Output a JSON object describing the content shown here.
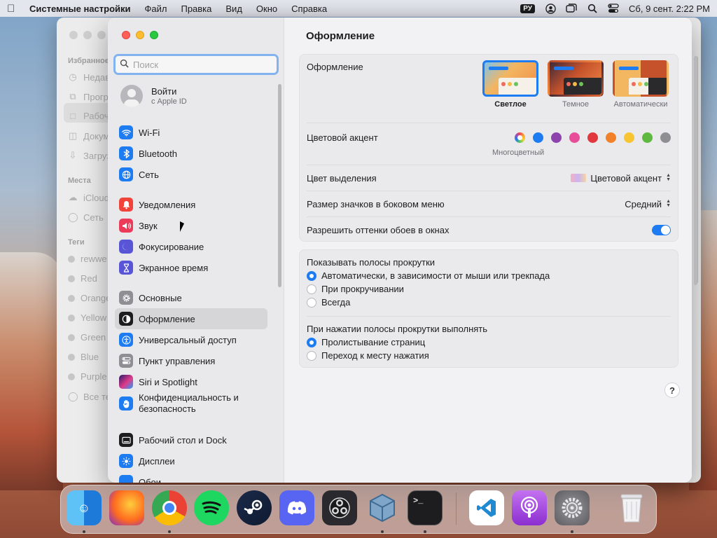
{
  "menubar": {
    "app_name": "Системные настройки",
    "items": [
      "Файл",
      "Правка",
      "Вид",
      "Окно",
      "Справка"
    ],
    "input_source": "РУ",
    "datetime": "Сб, 9 сент.  2:22 PM"
  },
  "finder": {
    "sections": [
      "Избранное",
      "Места",
      "Теги"
    ],
    "favorites": [
      "Недавние",
      "Программы",
      "Рабочий стол",
      "Документы",
      "Загрузки"
    ],
    "places": [
      "iCloud Drive",
      "Сеть"
    ],
    "tags": [
      "rewwe",
      "Red",
      "Orange",
      "Yellow",
      "Green",
      "Blue",
      "Purple",
      "Все теги…"
    ]
  },
  "sidebar": {
    "search_placeholder": "Поиск",
    "account": {
      "title": "Войти",
      "subtitle": "с Apple ID"
    },
    "items": [
      {
        "label": "Wi-Fi",
        "icon": "wifi-icon"
      },
      {
        "label": "Bluetooth",
        "icon": "bluetooth-icon"
      },
      {
        "label": "Сеть",
        "icon": "globe-icon"
      },
      {
        "label": "Уведомления",
        "icon": "bell-icon"
      },
      {
        "label": "Звук",
        "icon": "speaker-icon"
      },
      {
        "label": "Фокусирование",
        "icon": "moon-icon"
      },
      {
        "label": "Экранное время",
        "icon": "hourglass-icon"
      },
      {
        "label": "Основные",
        "icon": "gear-icon"
      },
      {
        "label": "Оформление",
        "icon": "appearance-icon"
      },
      {
        "label": "Универсальный доступ",
        "icon": "accessibility-icon"
      },
      {
        "label": "Пункт управления",
        "icon": "control-center-icon"
      },
      {
        "label": "Siri и Spotlight",
        "icon": "siri-icon"
      },
      {
        "label": "Конфиденциальность и безопасность",
        "icon": "hand-icon"
      },
      {
        "label": "Рабочий стол и Dock",
        "icon": "dock-icon"
      },
      {
        "label": "Дисплеи",
        "icon": "sun-icon"
      },
      {
        "label": "Обои",
        "icon": "wallpaper-icon"
      }
    ],
    "selected": "Оформление"
  },
  "content": {
    "title": "Оформление",
    "appearance_label": "Оформление",
    "themes": [
      {
        "label": "Светлое",
        "selected": true
      },
      {
        "label": "Темное",
        "selected": false
      },
      {
        "label": "Автоматически",
        "selected": false
      }
    ],
    "accent_label": "Цветовой акцент",
    "accent_caption": "Многоцветный",
    "accent_colors": [
      "multicolor",
      "#1e7cf2",
      "#8e44ad",
      "#e84d9a",
      "#e0383e",
      "#f1822b",
      "#f7c52f",
      "#5fb83f",
      "#8e8e93"
    ],
    "highlight_label": "Цвет выделения",
    "highlight_value": "Цветовой акцент",
    "icon_size_label": "Размер значков в боковом меню",
    "icon_size_value": "Средний",
    "wallpaper_tint_label": "Разрешить оттенки обоев в окнах",
    "wallpaper_tint_on": true,
    "scrollbars_label": "Показывать полосы прокрутки",
    "scrollbar_options": [
      {
        "label": "Автоматически, в зависимости от мыши или трекпада",
        "selected": true
      },
      {
        "label": "При прокручивании",
        "selected": false
      },
      {
        "label": "Всегда",
        "selected": false
      }
    ],
    "click_label": "При нажатии полосы прокрутки выполнять",
    "click_options": [
      {
        "label": "Пролистывание страниц",
        "selected": true
      },
      {
        "label": "Переход к месту нажатия",
        "selected": false
      }
    ],
    "help": "?"
  },
  "dock": {
    "apps": [
      "Finder",
      "Firefox",
      "Chrome",
      "Spotify",
      "Steam",
      "Discord",
      "OBS",
      "VirtualBox",
      "Terminal",
      "VS Code",
      "Podcasts",
      "Системные настройки",
      "Корзина"
    ]
  }
}
